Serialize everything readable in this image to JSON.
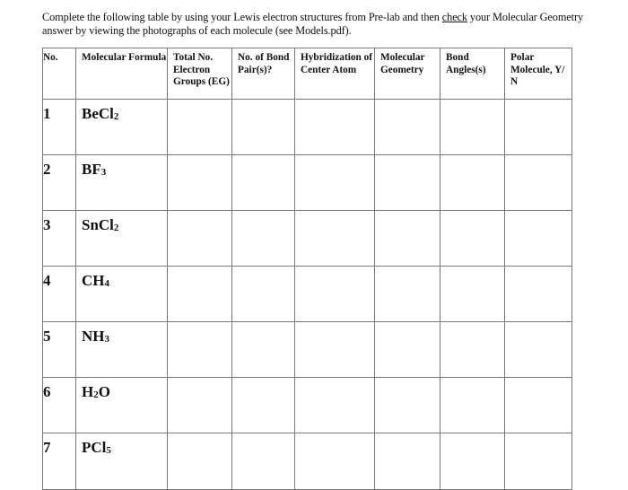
{
  "instructions": {
    "part1": "Complete the following table by using your Lewis electron structures from Pre-lab and then ",
    "underlined": "check",
    "part2": " your Molecular Geometry answer by viewing the photographs of each molecule (see Models.pdf)."
  },
  "table": {
    "headers": [
      "No.",
      "Molecular Formula",
      "Total No. Electron Groups (EG)",
      "No. of Bond Pair(s)?",
      "Hybridization of Center Atom",
      "Molecular Geometry",
      "Bond Angles(s)",
      "Polar Molecule, Y/ N"
    ],
    "rows": [
      {
        "no": "1",
        "formula": [
          {
            "t": "BeCl"
          },
          {
            "sub": "2"
          }
        ]
      },
      {
        "no": "2",
        "formula": [
          {
            "t": "BF"
          },
          {
            "sub": "3"
          }
        ]
      },
      {
        "no": "3",
        "formula": [
          {
            "t": "SnCl"
          },
          {
            "sub": "2"
          }
        ]
      },
      {
        "no": "4",
        "formula": [
          {
            "t": "CH"
          },
          {
            "sub": "4"
          }
        ]
      },
      {
        "no": "5",
        "formula": [
          {
            "t": "NH"
          },
          {
            "sub": "3"
          }
        ]
      },
      {
        "no": "6",
        "formula": [
          {
            "t": "H"
          },
          {
            "sub": "2"
          },
          {
            "t": "O"
          }
        ]
      },
      {
        "no": "7",
        "formula": [
          {
            "t": "PCl"
          },
          {
            "sub": "5"
          }
        ]
      }
    ]
  }
}
